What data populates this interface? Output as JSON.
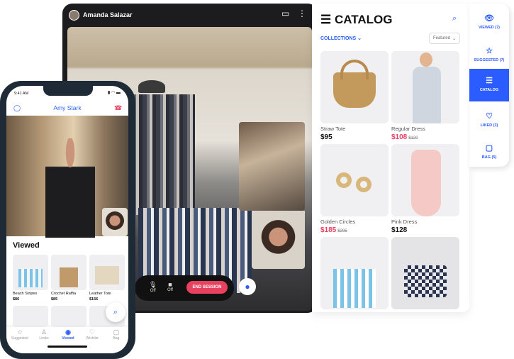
{
  "agent_view": {
    "participant_name": "Amanda Salazar",
    "mic_label": "Off",
    "camera_label": "Off",
    "end_session_label": "END SESSION",
    "icons": [
      "minimize-icon",
      "more-vertical-icon",
      "mic-icon",
      "camera-icon",
      "chat-icon"
    ]
  },
  "catalog": {
    "title": "CATALOG",
    "collections_label": "COLLECTIONS",
    "sort_value": "Featured",
    "products": [
      {
        "name": "Straw Tote",
        "price": "$95",
        "old_price": ""
      },
      {
        "name": "Regular Dress",
        "price": "$108",
        "old_price": "$120"
      },
      {
        "name": "Golden Circles",
        "price": "$185",
        "old_price": "$205"
      },
      {
        "name": "Pink Dress",
        "price": "$128",
        "old_price": ""
      }
    ]
  },
  "side_nav": {
    "items": [
      {
        "label": "VIEWED (7)",
        "icon": "eye-icon"
      },
      {
        "label": "SUGGESTED (7)",
        "icon": "star-icon"
      },
      {
        "label": "CATALOG",
        "icon": "list-icon",
        "active": true
      },
      {
        "label": "LIKED (3)",
        "icon": "heart-icon"
      },
      {
        "label": "BAG (5)",
        "icon": "bag-icon"
      }
    ]
  },
  "phone": {
    "time": "9:41 AM",
    "contact_name": "Amy Stark",
    "section_title": "Viewed",
    "items": [
      {
        "name": "Beach Stripes",
        "price": "$86"
      },
      {
        "name": "Crochet Raffia",
        "price": "$85"
      },
      {
        "name": "Leather Tote",
        "price": "$156"
      }
    ],
    "tabs": [
      {
        "label": "Suggested"
      },
      {
        "label": "Looks"
      },
      {
        "label": "Viewed",
        "active": true
      },
      {
        "label": "Wishlist"
      },
      {
        "label": "Bag"
      }
    ]
  },
  "colors": {
    "accent": "#2a5cff",
    "sale": "#e8405f"
  }
}
